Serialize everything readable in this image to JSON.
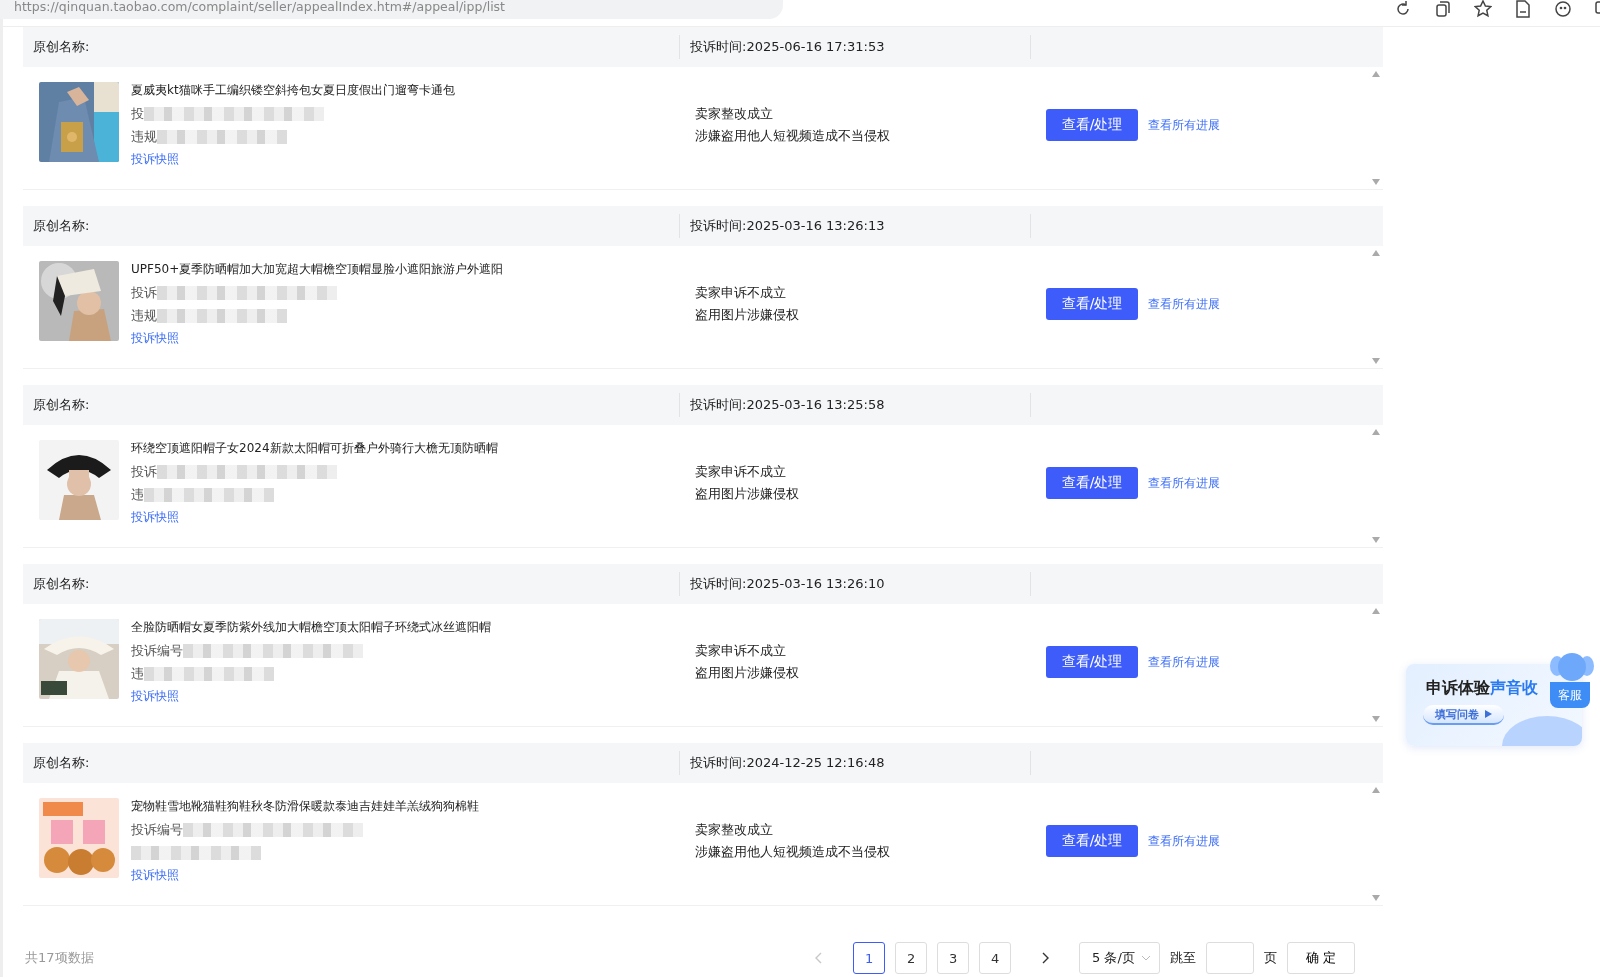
{
  "browser": {
    "url": "https://qinquan.taobao.com/complaint/seller/appealIndex.htm#/appeal/ipp/list"
  },
  "complaints": [
    {
      "name_label": "原创名称:",
      "time": "投诉时间:2025-06-16 17:31:53",
      "title": "夏威夷kt猫咪手工编织镂空斜挎包女夏日度假出门遛弯卡通包",
      "line_1": "投",
      "line_2": "违规",
      "snapshot_link": "投诉快照",
      "status": "卖家整改成立",
      "reason": "涉嫌盗用他人短视频造成不当侵权",
      "action_button": "查看/处理",
      "progress_link": "查看所有进展"
    },
    {
      "name_label": "原创名称:",
      "time": "投诉时间:2025-03-16 13:26:13",
      "title": "UPF50+夏季防晒帽加大加宽超大帽檐空顶帽显脸小遮阳旅游户外遮阳",
      "line_1": "投诉",
      "line_2": "违规",
      "snapshot_link": "投诉快照",
      "status": "卖家申诉不成立",
      "reason": "盗用图片涉嫌侵权",
      "action_button": "查看/处理",
      "progress_link": "查看所有进展"
    },
    {
      "name_label": "原创名称:",
      "time": "投诉时间:2025-03-16 13:25:58",
      "title": "环绕空顶遮阳帽子女2024新款太阳帽可折叠户外骑行大檐无顶防晒帽",
      "line_1": "投诉",
      "line_2": "违",
      "snapshot_link": "投诉快照",
      "status": "卖家申诉不成立",
      "reason": "盗用图片涉嫌侵权",
      "action_button": "查看/处理",
      "progress_link": "查看所有进展"
    },
    {
      "name_label": "原创名称:",
      "time": "投诉时间:2025-03-16 13:26:10",
      "title": "全脸防晒帽女夏季防紫外线加大帽檐空顶太阳帽子环绕式冰丝遮阳帽",
      "line_1": "投诉编号",
      "line_2": "违",
      "snapshot_link": "投诉快照",
      "status": "卖家申诉不成立",
      "reason": "盗用图片涉嫌侵权",
      "action_button": "查看/处理",
      "progress_link": "查看所有进展"
    },
    {
      "name_label": "原创名称:",
      "time": "投诉时间:2024-12-25 12:16:48",
      "title": "宠物鞋雪地靴猫鞋狗鞋秋冬防滑保暖款泰迪吉娃娃羊羔绒狗狗棉鞋",
      "line_1": "投诉编号",
      "snapshot_link": "投诉快照",
      "status": "卖家整改成立",
      "reason": "涉嫌盗用他人短视频造成不当侵权",
      "action_button": "查看/处理",
      "progress_link": "查看所有进展"
    }
  ],
  "pagination": {
    "total": "共17项数据",
    "prev": {
      "disabled": true
    },
    "pages": [
      {
        "label": "1",
        "selected": true
      },
      {
        "label": "2",
        "selected": false
      },
      {
        "label": "3",
        "selected": false
      },
      {
        "label": "4",
        "selected": false
      }
    ],
    "next": {
      "disabled": false
    },
    "page_size": "5 条/页",
    "jump_label": "跳至",
    "jump_unit": "页",
    "confirm": "确 定"
  },
  "survey": {
    "title": "申诉体验",
    "title_accent": "声音收",
    "button": "填写问卷",
    "service": "客服"
  }
}
